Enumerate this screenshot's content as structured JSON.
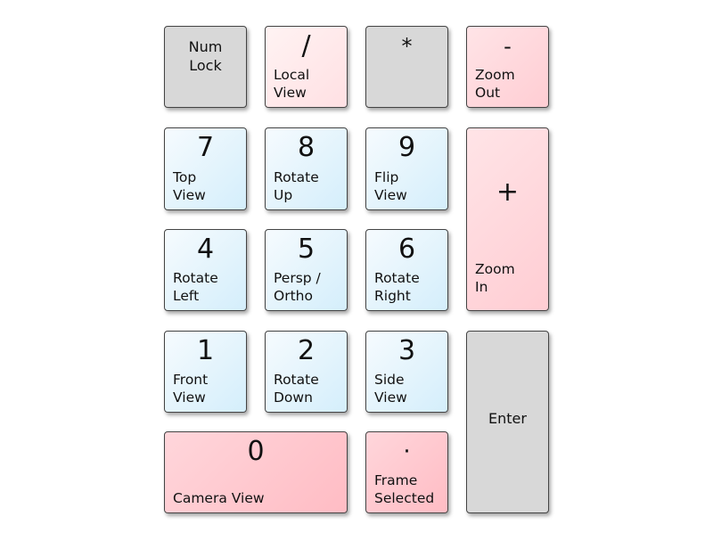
{
  "keys": {
    "numlock": {
      "label": "Num\nLock"
    },
    "divide": {
      "symbol": "/",
      "label": "Local\nView"
    },
    "multiply": {
      "symbol": "*"
    },
    "minus": {
      "symbol": "-",
      "label": "Zoom\nOut"
    },
    "k7": {
      "symbol": "7",
      "label": "Top\nView"
    },
    "k8": {
      "symbol": "8",
      "label": "Rotate\nUp"
    },
    "k9": {
      "symbol": "9",
      "label": "Flip\nView"
    },
    "plus": {
      "symbol": "+",
      "label": "Zoom\nIn"
    },
    "k4": {
      "symbol": "4",
      "label": "Rotate\nLeft"
    },
    "k5": {
      "symbol": "5",
      "label": "Persp /\nOrtho"
    },
    "k6": {
      "symbol": "6",
      "label": "Rotate\nRight"
    },
    "k1": {
      "symbol": "1",
      "label": "Front\nView"
    },
    "k2": {
      "symbol": "2",
      "label": "Rotate\nDown"
    },
    "k3": {
      "symbol": "3",
      "label": "Side\nView"
    },
    "enter": {
      "label": "Enter"
    },
    "k0": {
      "symbol": "0",
      "label": "Camera View"
    },
    "dot": {
      "symbol": "·",
      "label": "Frame\nSelected"
    }
  },
  "colors": {
    "gray": "#d8d8d8",
    "light_pink": "#ffe8ea",
    "pink": "#ffd6db",
    "deep_pink": "#ffc6cd",
    "blue": "#dff2fc"
  }
}
